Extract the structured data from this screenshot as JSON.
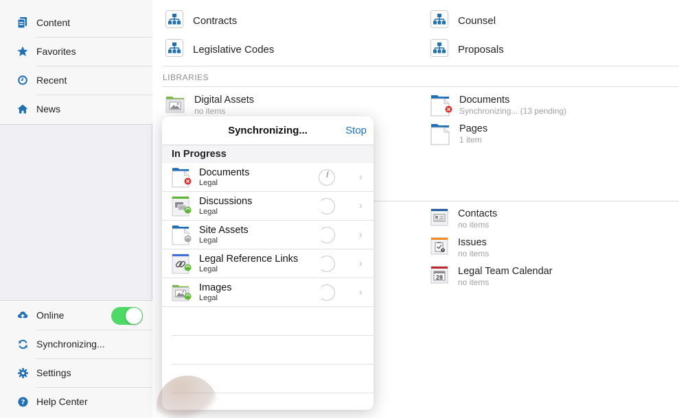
{
  "sidebar": {
    "top_items": [
      {
        "label": "Content",
        "icon": "content-icon"
      },
      {
        "label": "Favorites",
        "icon": "star-icon"
      },
      {
        "label": "Recent",
        "icon": "clock-icon"
      },
      {
        "label": "News",
        "icon": "home-icon"
      }
    ],
    "bottom_items": [
      {
        "label": "Online",
        "icon": "cloud-upload-icon",
        "toggle_on": true
      },
      {
        "label": "Synchronizing...",
        "icon": "sync-icon"
      },
      {
        "label": "Settings",
        "icon": "gear-icon"
      },
      {
        "label": "Help Center",
        "icon": "help-icon"
      }
    ]
  },
  "main": {
    "sites": [
      {
        "label": "Contracts",
        "icon": "site-hierarchy-icon"
      },
      {
        "label": "Counsel",
        "icon": "site-hierarchy-icon"
      },
      {
        "label": "Legislative Codes",
        "icon": "site-hierarchy-icon"
      },
      {
        "label": "Proposals",
        "icon": "site-hierarchy-icon"
      }
    ],
    "libraries_header": "LIBRARIES",
    "libraries": [
      {
        "title": "Digital Assets",
        "subtitle": "no items",
        "icon": "image-folder-icon"
      },
      {
        "title": "Documents",
        "subtitle": "Synchronizing... (13 pending)",
        "icon": "document-folder-icon"
      },
      {
        "title": "Pages",
        "subtitle": "1 item",
        "icon": "document-folder-icon"
      }
    ],
    "lists": [
      {
        "title": "Contacts",
        "subtitle": "no items",
        "icon": "contacts-icon"
      },
      {
        "title": "Issues",
        "subtitle": "no items",
        "icon": "issues-icon"
      },
      {
        "title": "Legal Team Calendar",
        "subtitle": "no items",
        "icon": "calendar-icon",
        "calendar_day": "28"
      }
    ]
  },
  "popover": {
    "title": "Synchronizing...",
    "stop_label": "Stop",
    "section_label": "In Progress",
    "items": [
      {
        "title": "Documents",
        "subtitle": "Legal",
        "icon": "document-folder-icon",
        "badge": "error"
      },
      {
        "title": "Discussions",
        "subtitle": "Legal",
        "icon": "discussion-icon",
        "badge": "sync"
      },
      {
        "title": "Site Assets",
        "subtitle": "Legal",
        "icon": "document-folder-icon",
        "badge": "pending"
      },
      {
        "title": "Legal Reference Links",
        "subtitle": "Legal",
        "icon": "link-icon",
        "badge": "sync"
      },
      {
        "title": "Images",
        "subtitle": "Legal",
        "icon": "image-folder-icon",
        "badge": "sync"
      }
    ]
  },
  "colors": {
    "accent": "#1a73c9",
    "toggle_on": "#4cd964",
    "icon_blue": "#1d6fb8",
    "error_red": "#e0302a",
    "sync_green": "#5cb832"
  }
}
